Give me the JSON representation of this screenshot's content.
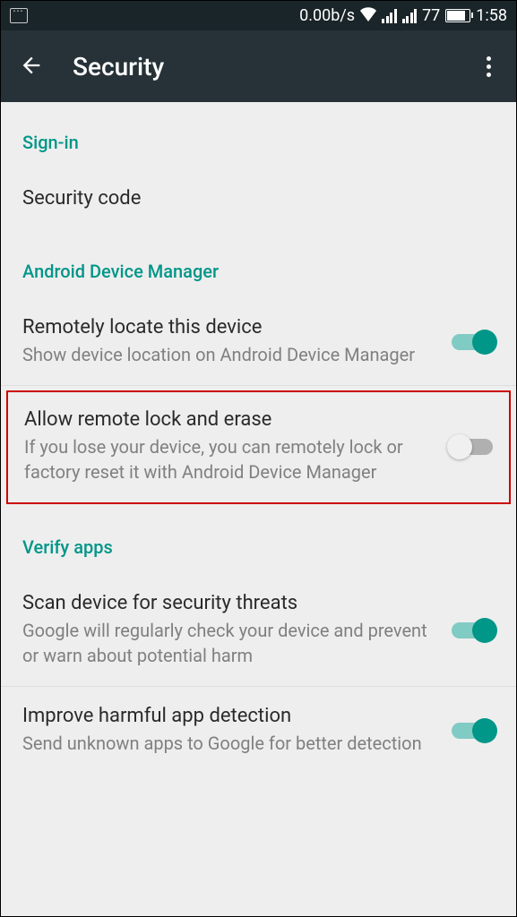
{
  "status_bar": {
    "network_speed": "0.00b/s",
    "battery_percent": "77",
    "time": "1:58"
  },
  "app_bar": {
    "title": "Security"
  },
  "sections": {
    "signin": {
      "header": "Sign-in",
      "items": {
        "security_code": {
          "title": "Security code"
        }
      }
    },
    "adm": {
      "header": "Android Device Manager",
      "items": {
        "locate": {
          "title": "Remotely locate this device",
          "subtitle": "Show device location on Android Device Manager",
          "enabled": true
        },
        "lock_erase": {
          "title": "Allow remote lock and erase",
          "subtitle": "If you lose your device, you can remotely lock or factory reset it with Android Device Manager",
          "enabled": false
        }
      }
    },
    "verify": {
      "header": "Verify apps",
      "items": {
        "scan": {
          "title": "Scan device for security threats",
          "subtitle": "Google will regularly check your device and prevent or warn about potential harm",
          "enabled": true
        },
        "improve": {
          "title": "Improve harmful app detection",
          "subtitle": "Send unknown apps to Google for better detection",
          "enabled": true
        }
      }
    }
  }
}
